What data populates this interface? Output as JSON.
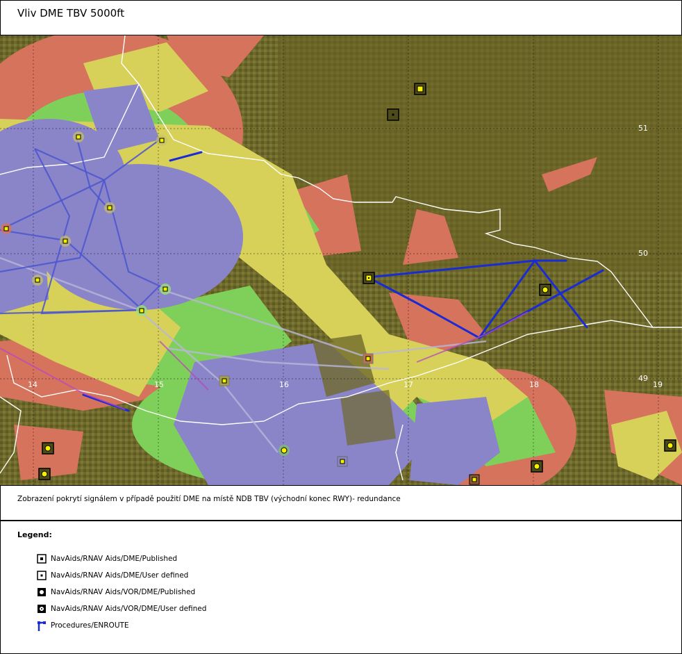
{
  "title": "Vliv DME TBV 5000ft",
  "caption": "Zobrazení pokrytí signálem v případě použití DME na místě NDB TBV (východní konec RWY)- redundance",
  "map": {
    "longitude_labels": [
      "14",
      "15",
      "16",
      "17",
      "18",
      "19"
    ],
    "latitude_labels": [
      "51",
      "50",
      "49"
    ],
    "colors": {
      "terrain_dark": "#5f5a22",
      "terrain_light": "#7c7733",
      "coverage_red": "#d6735d",
      "coverage_green": "#7fd05a",
      "coverage_yellow": "#d7d15a",
      "coverage_blue": "#8a84c8",
      "route_blue": "#1a2bd4",
      "border_white": "#ffffff"
    }
  },
  "legend": {
    "title": "Legend:",
    "items": [
      {
        "label": "NavAids/RNAV Aids/DME/Published",
        "icon": "dme-published-icon"
      },
      {
        "label": "NavAids/RNAV Aids/DME/User defined",
        "icon": "dme-user-defined-icon"
      },
      {
        "label": "NavAids/RNAV Aids/VOR/DME/Published",
        "icon": "vor-dme-published-icon"
      },
      {
        "label": "NavAids/RNAV Aids/VOR/DME/User defined",
        "icon": "vor-dme-user-defined-icon"
      },
      {
        "label": "Procedures/ENROUTE",
        "icon": "enroute-procedure-icon"
      }
    ]
  }
}
